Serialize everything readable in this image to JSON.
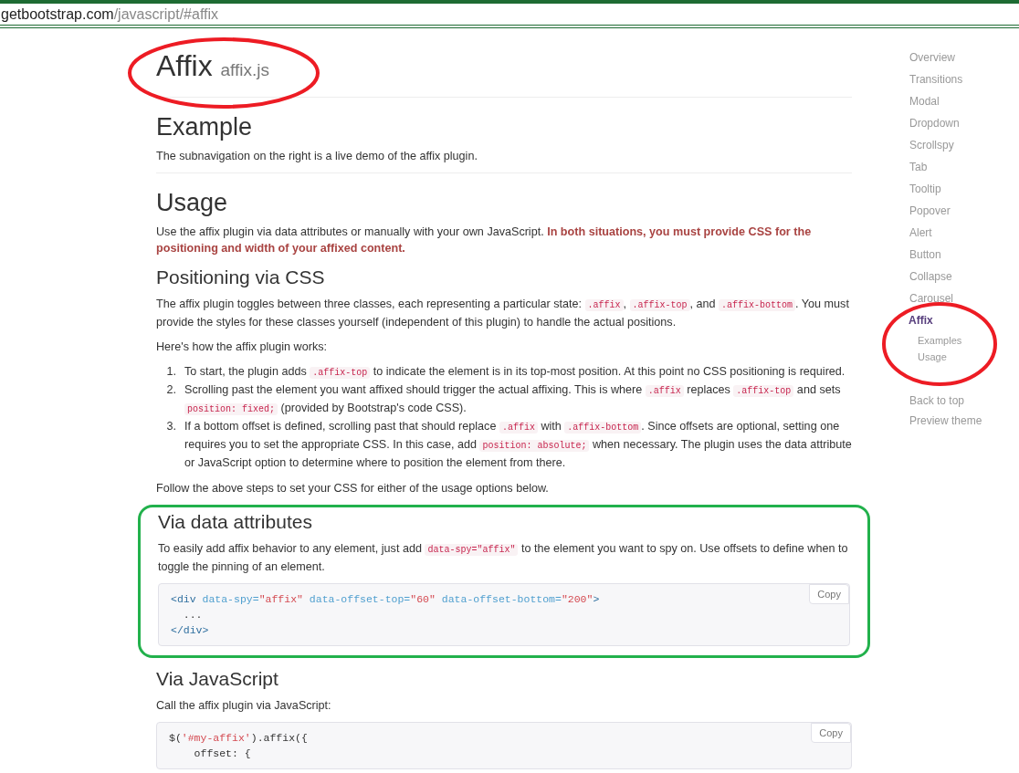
{
  "address_bar": {
    "host": "getbootstrap.com",
    "path": "/javascript/#affix"
  },
  "content": [
    {
      "kind": "h1",
      "text": "Affix",
      "small": "affix.js"
    },
    {
      "kind": "hr"
    },
    {
      "kind": "h2",
      "text": "Example"
    },
    {
      "kind": "p",
      "segments": [
        {
          "kind": "text",
          "text": "The subnavigation on the right is a live demo of the affix plugin."
        }
      ]
    },
    {
      "kind": "hr"
    },
    {
      "kind": "h2",
      "text": "Usage"
    },
    {
      "kind": "p",
      "segments": [
        {
          "kind": "text",
          "text": "Use the affix plugin via data attributes or manually with your own JavaScript. "
        },
        {
          "kind": "strong",
          "text": "In both situations, you must provide CSS for the positioning and width of your affixed content."
        }
      ]
    },
    {
      "kind": "h3",
      "text": "Positioning via CSS"
    },
    {
      "kind": "p",
      "segments": [
        {
          "kind": "text",
          "text": "The affix plugin toggles between three classes, each representing a particular state: "
        },
        {
          "kind": "code",
          "text": ".affix"
        },
        {
          "kind": "text",
          "text": ", "
        },
        {
          "kind": "code",
          "text": ".affix-top"
        },
        {
          "kind": "text",
          "text": ", and "
        },
        {
          "kind": "code",
          "text": ".affix-bottom"
        },
        {
          "kind": "text",
          "text": ". You must provide the styles for these classes yourself (independent of this plugin) to handle the actual positions."
        }
      ]
    },
    {
      "kind": "p",
      "segments": [
        {
          "kind": "text",
          "text": "Here's how the affix plugin works:"
        }
      ]
    },
    {
      "kind": "ol",
      "items": [
        {
          "number": "1.",
          "segments": [
            {
              "kind": "text",
              "text": "To start, the plugin adds "
            },
            {
              "kind": "code",
              "text": ".affix-top"
            },
            {
              "kind": "text",
              "text": " to indicate the element is in its top-most position. At this point no CSS positioning is required."
            }
          ]
        },
        {
          "number": "2.",
          "segments": [
            {
              "kind": "text",
              "text": "Scrolling past the element you want affixed should trigger the actual affixing. This is where "
            },
            {
              "kind": "code",
              "text": ".affix"
            },
            {
              "kind": "text",
              "text": " replaces "
            },
            {
              "kind": "code",
              "text": ".affix-top"
            },
            {
              "kind": "text",
              "text": " and sets "
            },
            {
              "kind": "code",
              "text": "position: fixed;"
            },
            {
              "kind": "text",
              "text": " (provided by Bootstrap's code CSS)."
            }
          ]
        },
        {
          "number": "3.",
          "segments": [
            {
              "kind": "text",
              "text": "If a bottom offset is defined, scrolling past that should replace "
            },
            {
              "kind": "code",
              "text": ".affix"
            },
            {
              "kind": "text",
              "text": " with "
            },
            {
              "kind": "code",
              "text": ".affix-bottom"
            },
            {
              "kind": "text",
              "text": ". Since offsets are optional, setting one requires you to set the appropriate CSS. In this case, add "
            },
            {
              "kind": "code",
              "text": "position: absolute;"
            },
            {
              "kind": "text",
              "text": " when necessary. The plugin uses the data attribute or JavaScript option to determine where to position the element from there."
            }
          ]
        }
      ]
    },
    {
      "kind": "p",
      "segments": [
        {
          "kind": "text",
          "text": "Follow the above steps to set your CSS for either of the usage options below."
        }
      ]
    },
    {
      "kind": "section",
      "highlighted": true,
      "blocks": [
        {
          "kind": "h3",
          "text": "Via data attributes"
        },
        {
          "kind": "p",
          "segments": [
            {
              "kind": "text",
              "text": "To easily add affix behavior to any element, just add "
            },
            {
              "kind": "code",
              "text": "data-spy=\"affix\""
            },
            {
              "kind": "text",
              "text": " to the element you want to spy on. Use offsets to define when to toggle the pinning of an element."
            }
          ]
        },
        {
          "kind": "code",
          "button": "Copy",
          "lines": [
            [
              {
                "kind": "tag",
                "text": "<div"
              },
              {
                "kind": "attr",
                "text": " data-spy="
              },
              {
                "kind": "string",
                "text": "\"affix\""
              },
              {
                "kind": "attr",
                "text": " data-offset-top="
              },
              {
                "kind": "string",
                "text": "\"60\""
              },
              {
                "kind": "attr",
                "text": " data-offset-bottom="
              },
              {
                "kind": "string",
                "text": "\"200\""
              },
              {
                "kind": "tag",
                "text": ">"
              }
            ],
            [
              {
                "kind": "plain",
                "text": "  ..."
              }
            ],
            [
              {
                "kind": "tag",
                "text": "</div>"
              }
            ]
          ]
        }
      ]
    },
    {
      "kind": "h3",
      "text": "Via JavaScript"
    },
    {
      "kind": "p",
      "segments": [
        {
          "kind": "text",
          "text": "Call the affix plugin via JavaScript:"
        }
      ]
    },
    {
      "kind": "code",
      "button": "Copy",
      "lines": [
        [
          {
            "kind": "plain",
            "text": "$("
          },
          {
            "kind": "string",
            "text": "'#my-affix'"
          },
          {
            "kind": "plain",
            "text": ").affix({"
          }
        ],
        [
          {
            "kind": "plain",
            "text": "    offset: {"
          }
        ]
      ]
    }
  ],
  "sidebar": {
    "items": [
      {
        "label": "Overview",
        "selected": false
      },
      {
        "label": "Transitions",
        "selected": false
      },
      {
        "label": "Modal",
        "selected": false
      },
      {
        "label": "Dropdown",
        "selected": false
      },
      {
        "label": "Scrollspy",
        "selected": false
      },
      {
        "label": "Tab",
        "selected": false
      },
      {
        "label": "Tooltip",
        "selected": false
      },
      {
        "label": "Popover",
        "selected": false
      },
      {
        "label": "Alert",
        "selected": false
      },
      {
        "label": "Button",
        "selected": false
      },
      {
        "label": "Collapse",
        "selected": false
      },
      {
        "label": "Carousel",
        "selected": false
      },
      {
        "label": "Affix",
        "selected": true,
        "children": [
          {
            "label": "Examples",
            "selected": false
          },
          {
            "label": "Usage",
            "selected": false
          }
        ]
      }
    ],
    "footer_links": [
      "Back to top",
      "Preview theme"
    ]
  }
}
